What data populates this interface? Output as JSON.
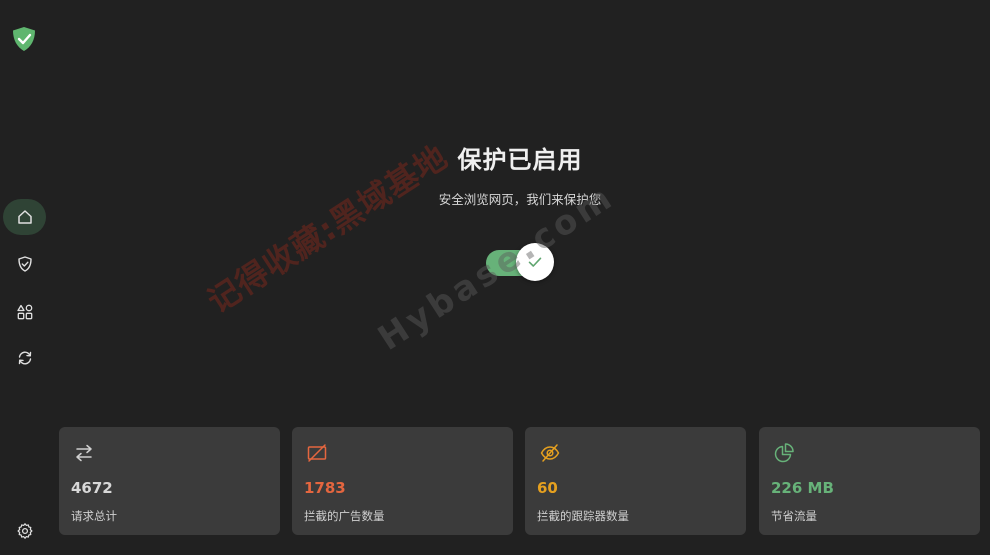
{
  "hero": {
    "title": "保护已启用",
    "subtitle": "安全浏览网页，我们来保护您",
    "toggle_on": true
  },
  "watermark": {
    "line1": "记得收藏:黑域基地",
    "line2": "Hybase.com"
  },
  "sidebar": {
    "items": [
      {
        "name": "home",
        "icon": "home-icon",
        "active": true
      },
      {
        "name": "protection",
        "icon": "shield-icon",
        "active": false
      },
      {
        "name": "apps",
        "icon": "apps-icon",
        "active": false
      },
      {
        "name": "sync",
        "icon": "sync-icon",
        "active": false
      },
      {
        "name": "settings",
        "icon": "gear-icon",
        "active": false
      }
    ]
  },
  "stats": [
    {
      "value": "4672",
      "label": "请求总计",
      "icon": "transfer-arrows-icon",
      "color": "#d8d8d8"
    },
    {
      "value": "1783",
      "label": "拦截的广告数量",
      "icon": "ad-blocked-icon",
      "color": "#e5663f"
    },
    {
      "value": "60",
      "label": "拦截的跟踪器数量",
      "icon": "eye-off-icon",
      "color": "#e5a01f"
    },
    {
      "value": "226 MB",
      "label": "节省流量",
      "icon": "pie-chart-icon",
      "color": "#67b279"
    }
  ],
  "colors": {
    "accent": "#67b279",
    "background": "#212121",
    "card": "#3b3b3b",
    "sidebar_active": "#2f4335"
  }
}
